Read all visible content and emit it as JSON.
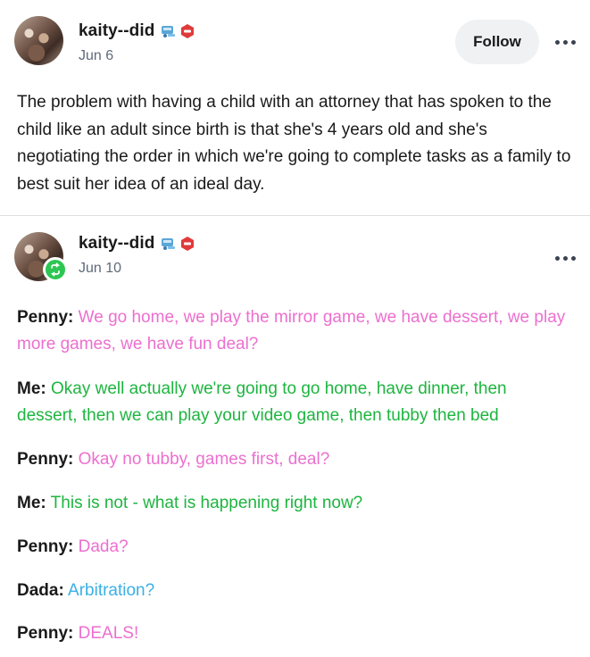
{
  "post1": {
    "username": "kaity--did",
    "date": "Jun 6",
    "follow_label": "Follow",
    "body": "The problem with having a child with an attorney that has spoken to the child like an adult since birth is that she's 4 years old and she's negotiating the order in which we're going to complete tasks as a family to best suit her idea of  an ideal day."
  },
  "post2": {
    "username": "kaity--did",
    "date": "Jun 10",
    "dialogue": [
      {
        "speaker": "Penny:",
        "text": "We go home, we play the mirror game, we have dessert, we play more games, we have fun deal?",
        "color": "#ec6fcf"
      },
      {
        "speaker": "Me:",
        "text": "Okay well actually we're going to go home, have dinner, then dessert, then we can play your video game, then tubby then bed",
        "color": "#1db53f"
      },
      {
        "speaker": "Penny:",
        "text": "Okay no tubby, games first, deal?",
        "color": "#ec6fcf"
      },
      {
        "speaker": "Me:",
        "text": "This is not - what is happening right now?",
        "color": "#1db53f"
      },
      {
        "speaker": "Penny:",
        "text": "Dada?",
        "color": "#ec6fcf"
      },
      {
        "speaker": "Dada:",
        "text": "Arbitration?",
        "color": "#3ab0e6"
      },
      {
        "speaker": "Penny:",
        "text": "DEALS!",
        "color": "#ec6fcf"
      }
    ]
  },
  "icons": {
    "badge_1": "ticket-robot-icon",
    "badge_2": "red-hexagon-badge-icon",
    "reblog": "reblog-icon",
    "more": "more-options-icon"
  }
}
